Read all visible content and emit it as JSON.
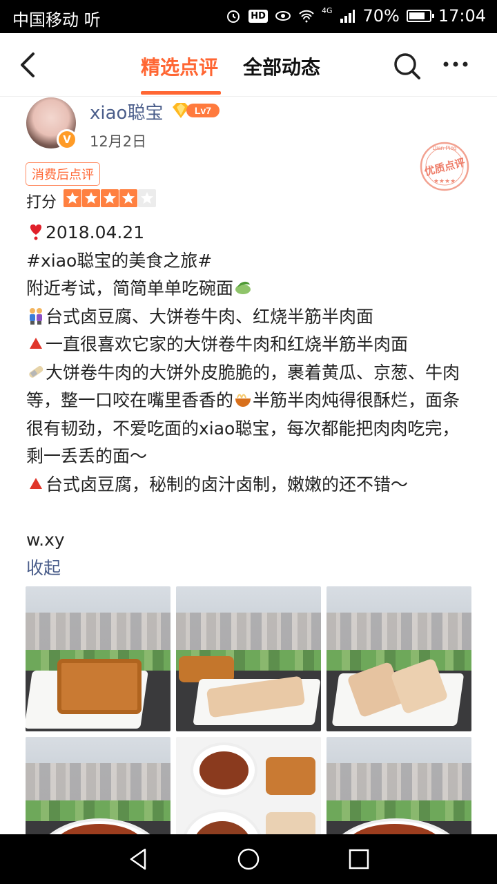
{
  "status_bar": {
    "carrier": "中国移动 听",
    "signal": "4G",
    "battery": "70%",
    "time": "17:04",
    "hd": "HD"
  },
  "header": {
    "tabs": [
      {
        "label": "精选点评",
        "active": true
      },
      {
        "label": "全部动态",
        "active": false
      }
    ],
    "accent_color": "#ff6633"
  },
  "review": {
    "user": {
      "name": "xiao聪宝",
      "level": "Lv7",
      "verified": "V"
    },
    "date": "12月2日",
    "tag": "消费后点评",
    "stamp_text": "优质点评",
    "stamp_subtext": "Dian Ping",
    "score_label": "打分",
    "rating": 4,
    "rating_max": 5,
    "lines": [
      "2018.04.21",
      "#xiao聪宝的美食之旅#",
      "附近考试，简简单单吃碗面",
      "台式卤豆腐、大饼卷牛肉、红烧半筋半肉面",
      "一直很喜欢它家的大饼卷牛肉和红烧半筋半肉面",
      "大饼卷牛肉的大饼外皮脆脆的，裹着黄瓜、京葱、牛肉等，整一口咬在嘴里香香的",
      "半筋半肉炖得很酥烂，面条很有韧劲，不爱吃面的xiao聪宝，每次都能把肉肉吃完，剩一丢丢的面～",
      "台式卤豆腐，秘制的卤汁卤制，嫩嫩的还不错～"
    ],
    "signature": "w.xy",
    "collapse_label": "收起",
    "photo_count": 6
  }
}
